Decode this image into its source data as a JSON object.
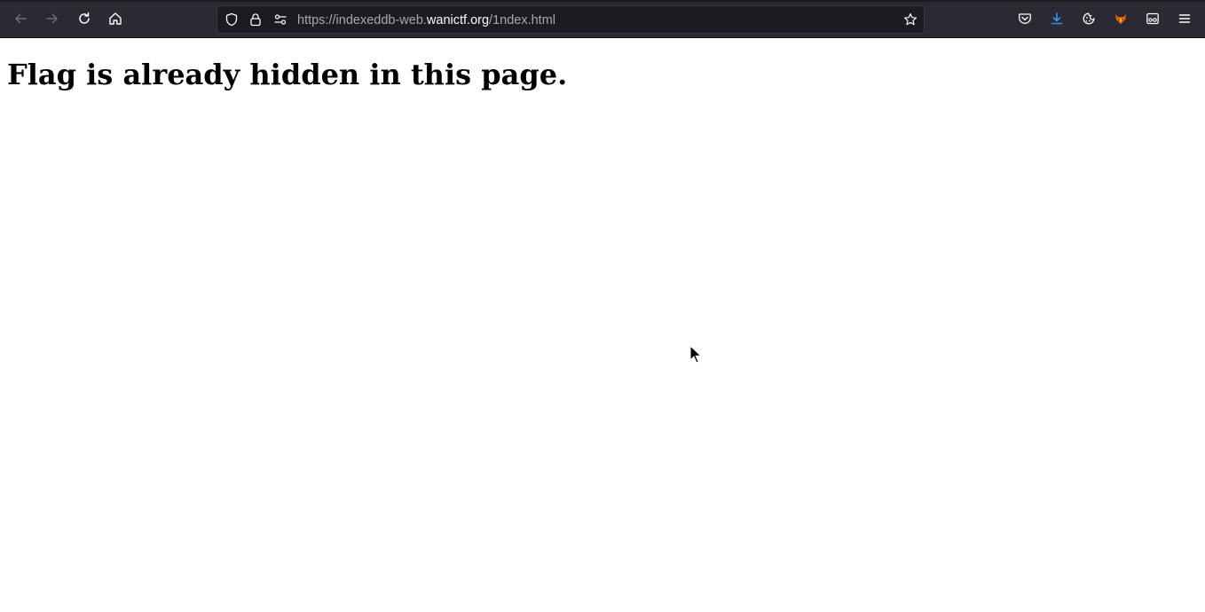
{
  "browser": {
    "url": {
      "scheme": "https://",
      "subdomain": "indexeddb-web.",
      "host": "wanictf.org",
      "path": "/1ndex.html"
    },
    "nav": {
      "back_icon": "arrow-left-icon",
      "forward_icon": "arrow-right-icon",
      "reload_icon": "reload-icon",
      "home_icon": "home-icon"
    },
    "right_icons": [
      "pocket-icon",
      "downloads-icon",
      "cookie-icon",
      "extension-fox-icon",
      "reader-view-icon",
      "menu-icon"
    ],
    "accent_color": "#0060df",
    "toolbar_color": "#2b2a33"
  },
  "page": {
    "heading": "Flag is already hidden in this page."
  }
}
